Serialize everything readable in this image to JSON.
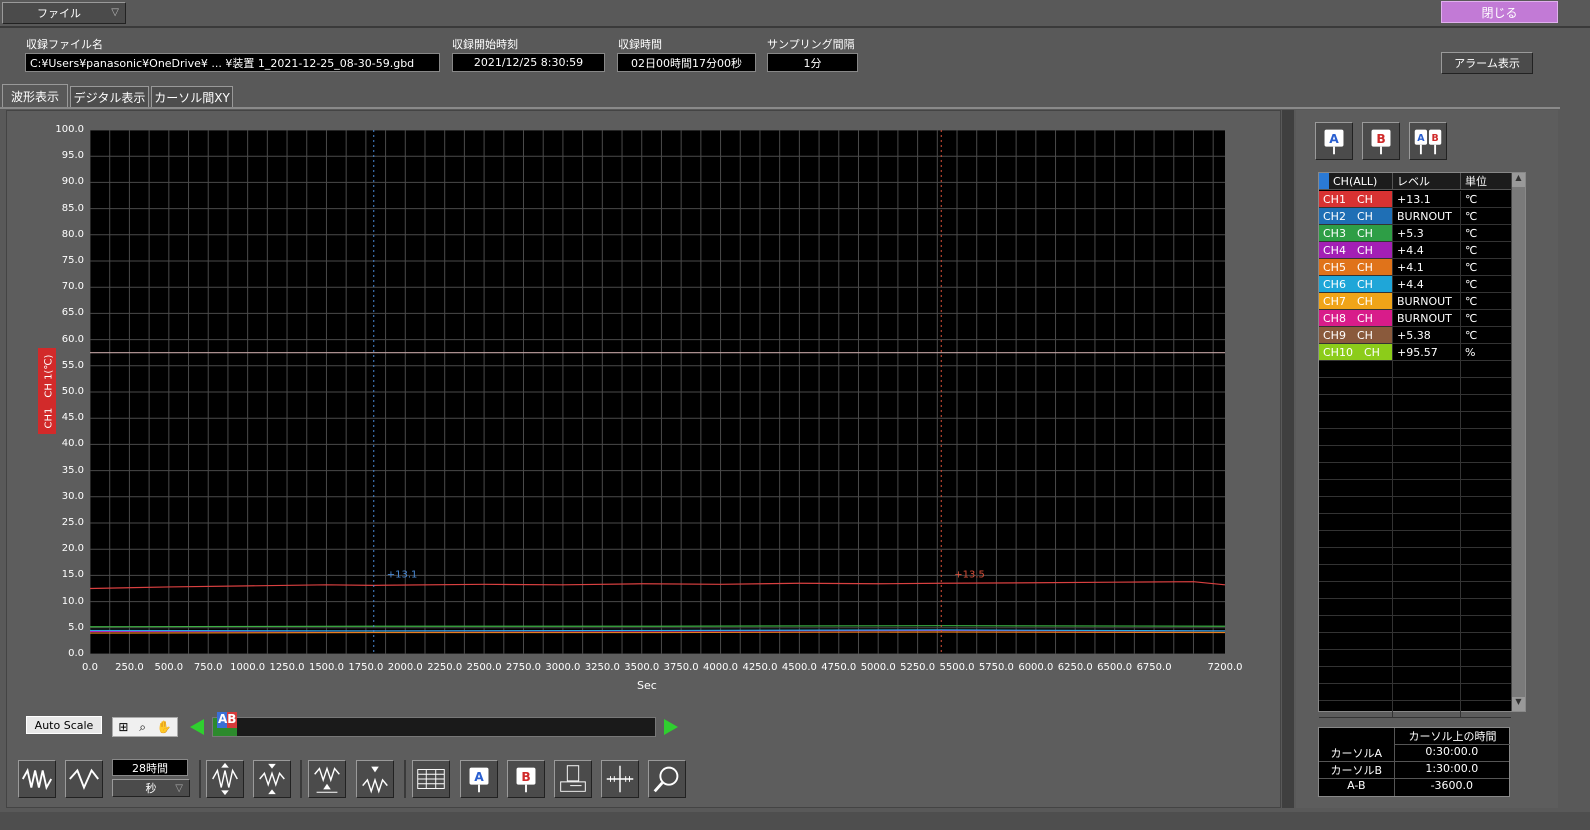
{
  "topbar": {
    "file_menu": "ファイル",
    "close_button": "閉じる"
  },
  "info": {
    "file_label": "収録ファイル名",
    "file_value": "C:¥Users¥panasonic¥OneDrive¥ ... ¥装置 1_2021-12-25_08-30-59.gbd",
    "start_label": "収録開始時刻",
    "start_value": "2021/12/25 8:30:59",
    "duration_label": "収録時間",
    "duration_value": "02日00時間17分00秒",
    "sampling_label": "サンプリング間隔",
    "sampling_value": "1分",
    "alarm_button": "アラーム表示"
  },
  "tabs": [
    {
      "label": "波形表示"
    },
    {
      "label": "デジタル表示"
    },
    {
      "label": "カーソル間XY"
    }
  ],
  "chart_data": {
    "type": "line",
    "xlabel": "Sec",
    "ylabel": "CH1　CH 1(℃)",
    "xlim": [
      0,
      7200
    ],
    "ylim": [
      0,
      100
    ],
    "yticks": [
      "100.0",
      "95.0",
      "90.0",
      "85.0",
      "80.0",
      "75.0",
      "70.0",
      "65.0",
      "60.0",
      "55.0",
      "50.0",
      "45.0",
      "40.0",
      "35.0",
      "30.0",
      "25.0",
      "20.0",
      "15.0",
      "10.0",
      "5.0",
      "0.0"
    ],
    "xticks": [
      "0.0",
      "250.0",
      "500.0",
      "750.0",
      "1000.0",
      "1250.0",
      "1500.0",
      "1750.0",
      "2000.0",
      "2250.0",
      "2500.0",
      "2750.0",
      "3000.0",
      "3250.0",
      "3500.0",
      "3750.0",
      "4000.0",
      "4250.0",
      "4500.0",
      "4750.0",
      "5000.0",
      "5250.0",
      "5500.0",
      "5750.0",
      "6000.0",
      "6250.0",
      "6500.0",
      "6750.0",
      "7200.0"
    ],
    "grid": true,
    "series": [
      {
        "color": "#d94040",
        "x": [
          0,
          500,
          1000,
          1500,
          1800,
          2500,
          3000,
          3500,
          4000,
          4500,
          5000,
          5400,
          6000,
          6500,
          7000,
          7200
        ],
        "y": [
          12.5,
          12.8,
          13.0,
          13.2,
          13.1,
          13.3,
          13.2,
          13.4,
          13.3,
          13.5,
          13.4,
          13.5,
          13.6,
          13.7,
          13.8,
          13.2
        ]
      },
      {
        "color": "#c2a3a3",
        "x": [
          0,
          1800,
          3600,
          5400,
          7200
        ],
        "y": [
          57.5,
          57.5,
          57.5,
          57.5,
          57.5
        ]
      },
      {
        "color": "#3cb043",
        "x": [
          0,
          1800,
          3600,
          5400,
          7200
        ],
        "y": [
          5.2,
          5.3,
          5.3,
          5.4,
          5.3
        ]
      },
      {
        "color": "#b020c0",
        "x": [
          0,
          1800,
          3600,
          5400,
          7200
        ],
        "y": [
          4.3,
          4.4,
          4.4,
          4.5,
          4.4
        ]
      },
      {
        "color": "#2aa8e0",
        "x": [
          0,
          1800,
          3600,
          5400,
          7200
        ],
        "y": [
          4.5,
          4.4,
          4.5,
          4.6,
          4.4
        ]
      },
      {
        "color": "#e87d1e",
        "x": [
          0,
          1800,
          3600,
          5400,
          7200
        ],
        "y": [
          4.0,
          4.1,
          4.1,
          4.2,
          4.1
        ]
      }
    ],
    "cursor_a": {
      "x": 1800,
      "label": "+13.1",
      "color": "#4a8ad6"
    },
    "cursor_b": {
      "x": 5400,
      "label": "+13.5",
      "color": "#d9503a"
    }
  },
  "controls": {
    "auto_scale": "Auto Scale",
    "time_span": "28時間",
    "unit_select": "秒",
    "marker_ab": "AB"
  },
  "channel_table": {
    "headers": [
      "CH(ALL)",
      "レベル",
      "単位"
    ],
    "rows": [
      {
        "ch": "CH1　CH",
        "level": "+13.1",
        "unit": "℃",
        "color": "#d83232"
      },
      {
        "ch": "CH2　CH",
        "level": " BURNOUT",
        "unit": "℃",
        "color": "#1f6fb5"
      },
      {
        "ch": "CH3　CH",
        "level": "+5.3",
        "unit": "℃",
        "color": "#2e9e46"
      },
      {
        "ch": "CH4　CH",
        "level": "+4.4",
        "unit": "℃",
        "color": "#a31fb5"
      },
      {
        "ch": "CH5　CH",
        "level": "+4.1",
        "unit": "℃",
        "color": "#e0731a"
      },
      {
        "ch": "CH6　CH",
        "level": "+4.4",
        "unit": "℃",
        "color": "#1fa6d8"
      },
      {
        "ch": "CH7　CH",
        "level": " BURNOUT",
        "unit": "℃",
        "color": "#f0a418"
      },
      {
        "ch": "CH8　CH",
        "level": " BURNOUT",
        "unit": "℃",
        "color": "#d81c8a"
      },
      {
        "ch": "CH9　CH",
        "level": "+5.38",
        "unit": "℃",
        "color": "#8a5a3c"
      },
      {
        "ch": "CH10　CH",
        "level": "+95.57",
        "unit": "%",
        "color": "#8ccc1a"
      }
    ]
  },
  "cursor_table": {
    "header": "カーソル上の時間",
    "rows": [
      {
        "label": "カーソルA",
        "value": "0:30:00.0"
      },
      {
        "label": "カーソルB",
        "value": "1:30:00.0"
      },
      {
        "label": "A-B",
        "value": "-3600.0"
      }
    ]
  },
  "icons": {
    "cursor_buttons": [
      "cursor-a-icon",
      "cursor-b-icon",
      "cursor-ab-icon"
    ],
    "toolbar": [
      "waveform-compress-icon",
      "waveform-expand-icon",
      "vertical-expand-icon",
      "vertical-compress-icon",
      "shift-up-icon",
      "shift-down-icon",
      "table-icon",
      "cursor-a-icon",
      "cursor-b-icon",
      "print-icon",
      "crosshair-icon",
      "zoom-icon"
    ]
  }
}
